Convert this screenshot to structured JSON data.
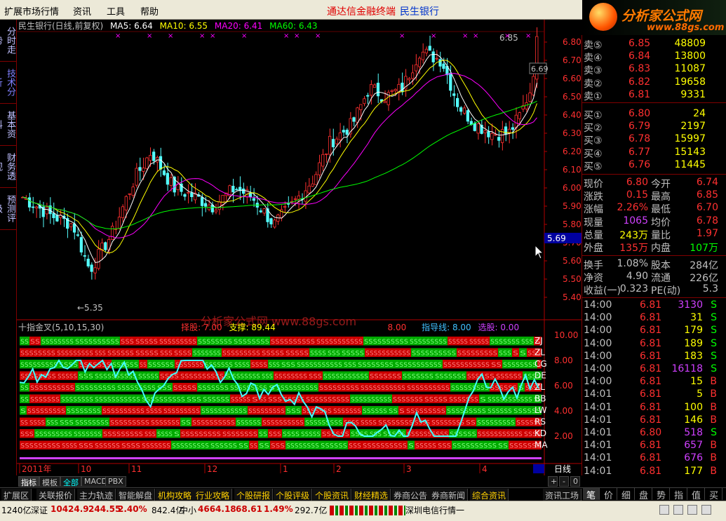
{
  "menu": {
    "items": [
      "扩展市场行情",
      "资讯",
      "工具",
      "帮助"
    ],
    "title": "通达信金融终端",
    "stock": "民生银行",
    "logo_text": "分析家公式网",
    "logo_url": "www.88gs.com"
  },
  "left_tabs": [
    "分时走势",
    "技术分析",
    "基本资料",
    "财务透视",
    "预测评级"
  ],
  "kline": {
    "title": "民生银行(日线,前复权)",
    "ma": [
      {
        "label": "MA5: 6.64",
        "color": "#ffffff"
      },
      {
        "label": "MA10: 6.55",
        "color": "#ffff00"
      },
      {
        "label": "MA20: 6.41",
        "color": "#ff00ff"
      },
      {
        "label": "MA60: 6.43",
        "color": "#00ff00"
      }
    ],
    "y_labels": [
      "6.80",
      "6.70",
      "6.60",
      "6.50",
      "6.40",
      "6.30",
      "6.20",
      "6.10",
      "6.00",
      "5.90",
      "5.80",
      "5.70",
      "5.60",
      "5.50",
      "5.40"
    ],
    "high_label": "6.85",
    "low_label": "5.35",
    "last_label": "6.69",
    "cursor_price": "5.69"
  },
  "indicator": {
    "title": "十指金叉(5,10,15,30)",
    "seg1": "择股: 7.00",
    "seg2": "支撑: 89.44",
    "seg3": "8.00",
    "seg4": "指导线: 8.00",
    "seg5": "选股: 0.00",
    "watermark": "分析家公式网 www.88gs.com",
    "y_labels": [
      "10.00",
      "8.00",
      "6.00",
      "4.00",
      "2.00"
    ],
    "row_labels": [
      "ZJ",
      "ZL",
      "CG",
      "DE",
      "ZL",
      "BB",
      "LW",
      "RS",
      "KD",
      "MA"
    ]
  },
  "xaxis": {
    "labels": [
      "2011年",
      "10",
      "11",
      "12",
      "1",
      "2",
      "3",
      "4"
    ],
    "period": "日线"
  },
  "quote": {
    "sell": [
      {
        "label": "卖⑤",
        "price": "6.85",
        "vol": "48809"
      },
      {
        "label": "卖④",
        "price": "6.84",
        "vol": "13800"
      },
      {
        "label": "卖③",
        "price": "6.83",
        "vol": "11087"
      },
      {
        "label": "卖②",
        "price": "6.82",
        "vol": "19658"
      },
      {
        "label": "卖①",
        "price": "6.81",
        "vol": "9331"
      }
    ],
    "buy": [
      {
        "label": "买①",
        "price": "6.80",
        "vol": "24"
      },
      {
        "label": "买②",
        "price": "6.79",
        "vol": "2197"
      },
      {
        "label": "买③",
        "price": "6.78",
        "vol": "15997"
      },
      {
        "label": "买④",
        "price": "6.77",
        "vol": "15143"
      },
      {
        "label": "买⑤",
        "price": "6.76",
        "vol": "11445"
      }
    ],
    "stats": [
      {
        "l1": "现价",
        "v1": "6.80",
        "c1": "#ff3030",
        "l2": "今开",
        "v2": "6.74",
        "c2": "#ff3030"
      },
      {
        "l1": "涨跌",
        "v1": "0.15",
        "c1": "#ff3030",
        "l2": "最高",
        "v2": "6.85",
        "c2": "#ff3030"
      },
      {
        "l1": "涨幅",
        "v1": "2.26%",
        "c1": "#ff3030",
        "l2": "最低",
        "v2": "6.70",
        "c2": "#ff3030"
      },
      {
        "l1": "现量",
        "v1": "1065",
        "c1": "#d040ff",
        "l2": "均价",
        "v2": "6.78",
        "c2": "#ff3030"
      },
      {
        "l1": "总量",
        "v1": "243万",
        "c1": "#ffff00",
        "l2": "量比",
        "v2": "1.97",
        "c2": "#ff3030"
      },
      {
        "l1": "外盘",
        "v1": "135万",
        "c1": "#ff3030",
        "l2": "内盘",
        "v2": "107万",
        "c2": "#00ff00"
      }
    ],
    "fin": [
      {
        "l1": "换手",
        "v1": "1.08%",
        "l2": "股本",
        "v2": "284亿"
      },
      {
        "l1": "净资",
        "v1": "4.90",
        "l2": "流通",
        "v2": "226亿"
      },
      {
        "l1": "收益(一)",
        "v1": "0.323",
        "l2": "PE(动)",
        "v2": "5.3"
      }
    ],
    "ticks": [
      {
        "t": "14:00",
        "p": "6.81",
        "v": "3130",
        "s": "S",
        "vc": "#d040ff"
      },
      {
        "t": "14:00",
        "p": "6.81",
        "v": "31",
        "s": "S",
        "vc": "#ffff00"
      },
      {
        "t": "14:00",
        "p": "6.81",
        "v": "179",
        "s": "S",
        "vc": "#ffff00"
      },
      {
        "t": "14:00",
        "p": "6.81",
        "v": "189",
        "s": "S",
        "vc": "#ffff00"
      },
      {
        "t": "14:00",
        "p": "6.81",
        "v": "183",
        "s": "S",
        "vc": "#ffff00"
      },
      {
        "t": "14:00",
        "p": "6.81",
        "v": "16118",
        "s": "S",
        "vc": "#d040ff"
      },
      {
        "t": "14:00",
        "p": "6.81",
        "v": "15",
        "s": "B",
        "vc": "#ffff00"
      },
      {
        "t": "14:01",
        "p": "6.81",
        "v": "5",
        "s": "B",
        "vc": "#ffff00"
      },
      {
        "t": "14:01",
        "p": "6.81",
        "v": "100",
        "s": "B",
        "vc": "#ffff00"
      },
      {
        "t": "14:01",
        "p": "6.81",
        "v": "146",
        "s": "B",
        "vc": "#ffff00"
      },
      {
        "t": "14:01",
        "p": "6.80",
        "v": "518",
        "s": "S",
        "vc": "#d040ff"
      },
      {
        "t": "14:01",
        "p": "6.81",
        "v": "657",
        "s": "B",
        "vc": "#d040ff"
      },
      {
        "t": "14:01",
        "p": "6.81",
        "v": "676",
        "s": "B",
        "vc": "#d040ff"
      },
      {
        "t": "14:01",
        "p": "6.81",
        "v": "177",
        "s": "B",
        "vc": "#ffff00"
      }
    ]
  },
  "bottom_tabs": [
    "指标",
    "模板",
    "全部",
    "MACD",
    "PBX"
  ],
  "func_tabs": [
    "扩展区",
    "关联报价",
    "主力轨迹",
    "智能解盘",
    "机构攻略",
    "行业攻略",
    "个股研报",
    "个股评级",
    "个股资讯",
    "财经精选",
    "券商公告",
    "券商新闻",
    "综合资讯",
    "资讯工场"
  ],
  "right_tabs": [
    "笔",
    "价",
    "细",
    "盘",
    "势",
    "指",
    "值",
    "买"
  ],
  "status": {
    "s0": "1240亿",
    "s1_label": "深证",
    "s1_val": "10424.9",
    "s1_chg": "244.55",
    "s1_pct": "2.40%",
    "s1_amt": "842.4亿",
    "s2_label": "中小",
    "s2_val": "4664.18",
    "s2_chg": "68.61",
    "s2_pct": "1.49%",
    "s2_amt": "292.7亿",
    "line": "深圳电信行情一"
  }
}
